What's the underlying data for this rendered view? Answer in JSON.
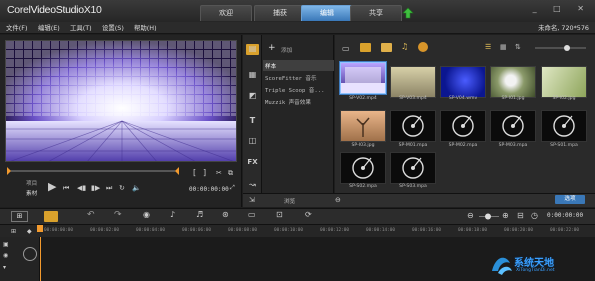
{
  "app": {
    "logo_part1": "Corel",
    "logo_part2": "VideoStudio",
    "logo_version": "X10"
  },
  "main_tabs": [
    {
      "label": "欢迎"
    },
    {
      "label": "捕获"
    },
    {
      "label": "编辑"
    },
    {
      "label": "共享"
    }
  ],
  "window_controls": "_ □ ✕",
  "menus": [
    {
      "label": "文件(F)"
    },
    {
      "label": "编辑(E)"
    },
    {
      "label": "工具(T)"
    },
    {
      "label": "设置(S)"
    },
    {
      "label": "帮助(H)"
    }
  ],
  "project_info": "未命名, 720*576",
  "preview": {
    "mode_project": "项目",
    "mode_clip": "素材",
    "timecode": "00:00:00:00",
    "bracket_in": "[",
    "bracket_out": "]"
  },
  "library": {
    "add_label": "添加",
    "folders": [
      {
        "label": "样本"
      },
      {
        "label": "ScoreFitter 音乐"
      },
      {
        "label": "Triple Scoop 音..."
      },
      {
        "label": "Muzzik 声音效果"
      }
    ],
    "browse_label": "浏览",
    "options_label": "选项",
    "thumbs_row1": [
      {
        "caption": "SP-V02.mp4",
        "kind": "video-purple"
      },
      {
        "caption": "SP-V03.mp4",
        "kind": "video-beige"
      },
      {
        "caption": "SP-V04.wmv",
        "kind": "video-blue"
      },
      {
        "caption": "SP-I01.jpg",
        "kind": "image-dandelion"
      },
      {
        "caption": "SP-I02.jpg",
        "kind": "image-green"
      }
    ],
    "thumbs_row2": [
      {
        "caption": "SP-I03.jpg",
        "kind": "image-tree"
      },
      {
        "caption": "SP-M01.mpa",
        "kind": "audio"
      },
      {
        "caption": "SP-M02.mpa",
        "kind": "audio"
      },
      {
        "caption": "SP-M03.mpa",
        "kind": "audio"
      },
      {
        "caption": "SP-S01.mpa",
        "kind": "audio"
      }
    ],
    "thumbs_row3": [
      {
        "caption": "SP-S02.mpa",
        "kind": "audio"
      },
      {
        "caption": "SP-S03.mpa",
        "kind": "audio"
      }
    ]
  },
  "timeline": {
    "timecode": "0:00:00:00",
    "ruler_ticks": [
      "00:00:00:00",
      "00:00:02:00",
      "00:00:04:00",
      "00:00:06:00",
      "00:00:08:00",
      "00:00:10:00",
      "00:00:12:00",
      "00:00:14:00",
      "00:00:16:00",
      "00:00:18:00",
      "00:00:20:00",
      "00:00:22:00"
    ]
  },
  "watermark": {
    "text": "系统天地",
    "site": "XiTongTianDi.net"
  },
  "colors": {
    "accent_blue": "#3a78b8",
    "selection_blue": "#8fc4ff",
    "upload_green": "#3fbf3f",
    "playhead_orange": "#f29a2e"
  }
}
